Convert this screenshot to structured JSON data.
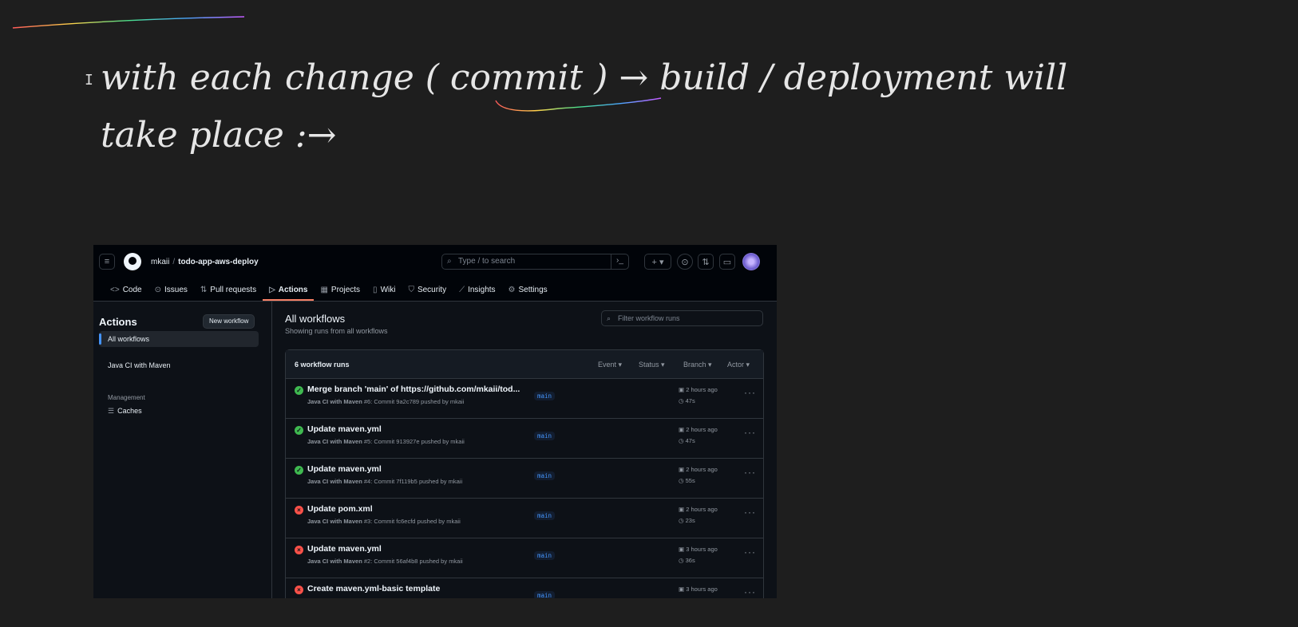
{
  "note": {
    "handwriting_line1": "with each change ( commit ) → build / deployment will",
    "handwriting_line2": "take place :→"
  },
  "github": {
    "header": {
      "owner": "mkaii",
      "separator": "/",
      "repo": "todo-app-aws-deploy",
      "search_placeholder": "Type / to search",
      "search_key": "/"
    },
    "nav_tabs": [
      {
        "label": "Code",
        "icon": "code-icon"
      },
      {
        "label": "Issues",
        "icon": "issue-icon"
      },
      {
        "label": "Pull requests",
        "icon": "pull-request-icon"
      },
      {
        "label": "Actions",
        "icon": "play-icon",
        "active": true
      },
      {
        "label": "Projects",
        "icon": "table-icon"
      },
      {
        "label": "Wiki",
        "icon": "book-icon"
      },
      {
        "label": "Security",
        "icon": "shield-icon"
      },
      {
        "label": "Insights",
        "icon": "graph-icon"
      },
      {
        "label": "Settings",
        "icon": "gear-icon"
      }
    ],
    "sidebar": {
      "title": "Actions",
      "new_workflow": "New workflow",
      "items": [
        {
          "label": "All workflows",
          "active": true
        },
        {
          "label": "Java CI with Maven"
        }
      ],
      "management_heading": "Management",
      "caches": "Caches"
    },
    "main": {
      "title": "All workflows",
      "subtitle": "Showing runs from all workflows",
      "filter_placeholder": "Filter workflow runs",
      "runs_count": "6 workflow runs",
      "filters": [
        "Event",
        "Status",
        "Branch",
        "Actor"
      ],
      "runs": [
        {
          "status": "success",
          "title": "Merge branch 'main' of https://github.com/mkaii/tod...",
          "workflow": "Java CI with Maven",
          "meta": "#6: Commit 9a2c789 pushed by mkaii",
          "branch": "main",
          "time": "2 hours ago",
          "duration": "47s"
        },
        {
          "status": "success",
          "title": "Update maven.yml",
          "workflow": "Java CI with Maven",
          "meta": "#5: Commit 913927e pushed by mkaii",
          "branch": "main",
          "time": "2 hours ago",
          "duration": "47s"
        },
        {
          "status": "success",
          "title": "Update maven.yml",
          "workflow": "Java CI with Maven",
          "meta": "#4: Commit 7f119b5 pushed by mkaii",
          "branch": "main",
          "time": "2 hours ago",
          "duration": "55s"
        },
        {
          "status": "failure",
          "title": "Update pom.xml",
          "workflow": "Java CI with Maven",
          "meta": "#3: Commit fc6ecfd pushed by mkaii",
          "branch": "main",
          "time": "2 hours ago",
          "duration": "23s"
        },
        {
          "status": "failure",
          "title": "Update maven.yml",
          "workflow": "Java CI with Maven",
          "meta": "#2: Commit 56af4b8 pushed by mkaii",
          "branch": "main",
          "time": "3 hours ago",
          "duration": "36s"
        },
        {
          "status": "failure",
          "title": "Create maven.yml-basic template",
          "workflow": "",
          "meta": "",
          "branch": "main",
          "time": "3 hours ago",
          "duration": ""
        }
      ]
    }
  }
}
